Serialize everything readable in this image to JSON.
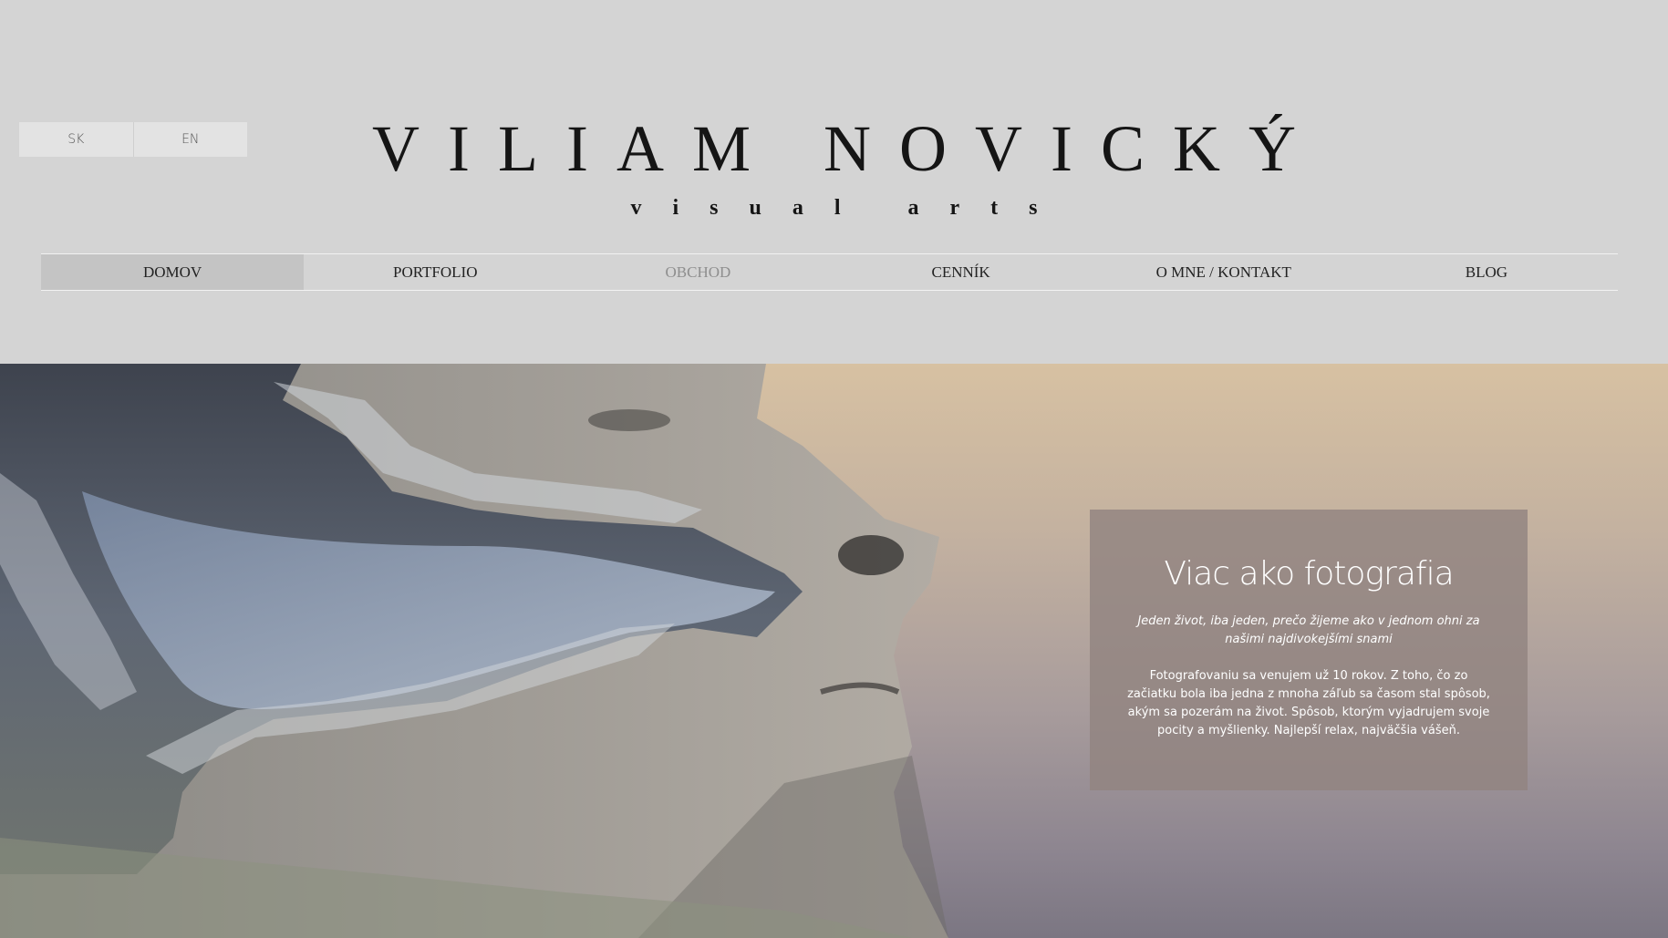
{
  "language_switch": {
    "sk_label": "SK",
    "en_label": "EN"
  },
  "brand": {
    "title": "VILIAM NOVICKÝ",
    "subtitle": "visual arts"
  },
  "nav": {
    "items": [
      {
        "label": "DOMOV"
      },
      {
        "label": "PORTFOLIO"
      },
      {
        "label": "OBCHOD"
      },
      {
        "label": "CENNÍK"
      },
      {
        "label": "O MNE / KONTAKT"
      },
      {
        "label": "BLOG"
      }
    ],
    "active": "DOMOV"
  },
  "hero": {
    "title": "Viac ako fotografia",
    "lead": "Jeden život, iba jeden, prečo žijeme ako v jednom ohni za našimi najdivokejšími snami",
    "body": "Fotografovaniu sa venujem už 10 rokov. Z toho, čo zo začiatku bola iba jedna z mnoha záľub sa časom stal spôsob, akým sa pozerám na život. Spôsob, ktorým vyjadrujem svoje pocity a myšlienky. Najlepší relax, najväčšia vášeň."
  },
  "colors": {
    "header_bg": "#d4d4d4",
    "nav_active_bg": "#c4c4c4",
    "info_box_bg": "#918480"
  }
}
